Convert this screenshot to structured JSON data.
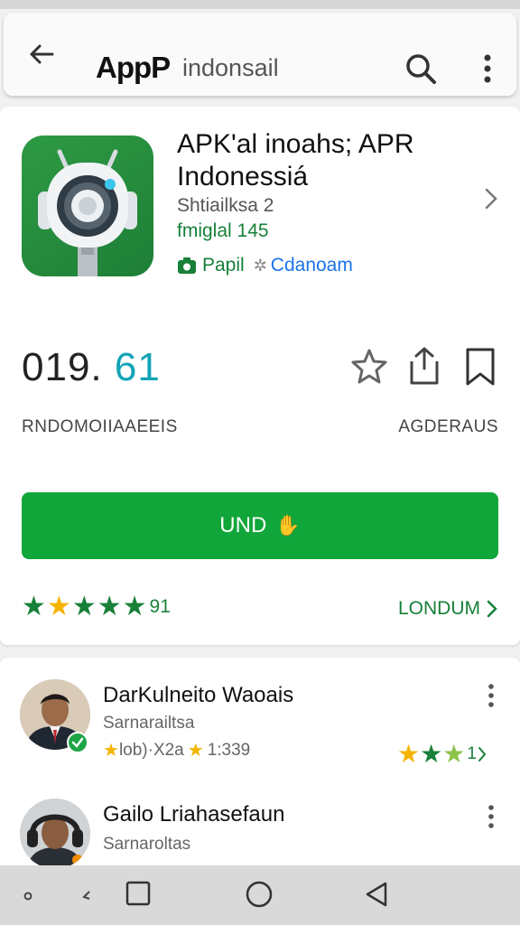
{
  "toolbar": {
    "brand": "AppP",
    "query": "indonsail"
  },
  "app": {
    "title": "APK'al inoahs; APR Indonessiá",
    "developer": "Shtiailksa 2",
    "category": "fmiglal 145",
    "tag1": "Papil",
    "tag2": "Cdanoam",
    "stat_a": "019.",
    "stat_b": "61",
    "label_left": "RNDOMOIIAAEEIS",
    "label_right": "AGDERAUS",
    "install_label": "UND",
    "rating_count": "91",
    "see_all": "LONDUM"
  },
  "reviews": [
    {
      "name": "DarKulneito Waoais",
      "subtitle": "Sarnarailtsa",
      "meta": "lob)·X2a",
      "meta_count": "1:339",
      "count": "1"
    },
    {
      "name": "Gailo Lriahasefaun",
      "subtitle": "Sarnaroltas"
    }
  ],
  "colors": {
    "accent_green": "#11a63a",
    "link_green": "#188038",
    "link_blue": "#1a73e8",
    "star_gold": "#f4b400"
  },
  "icons": {
    "back": "arrow-left-icon",
    "search": "search-icon",
    "menu": "more-vert-icon",
    "star": "star-outline-icon",
    "share": "share-icon",
    "bookmark": "bookmark-icon"
  }
}
